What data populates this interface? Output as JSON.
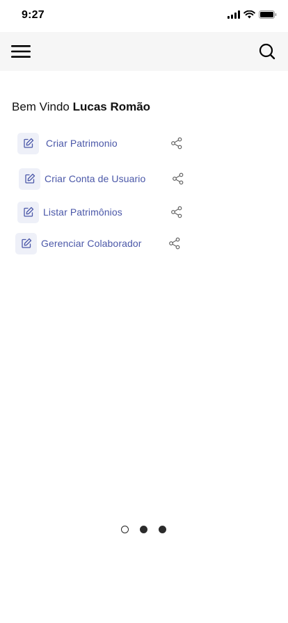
{
  "status_bar": {
    "time": "9:27",
    "icons": [
      "signal-icon",
      "wifi-icon",
      "battery-icon"
    ]
  },
  "header": {
    "menu_icon": "hamburger-menu-icon",
    "search_icon": "search-icon",
    "background": "#f6f6f6"
  },
  "welcome": {
    "greeting": "Bem Vindo",
    "user_name": "Lucas Romão"
  },
  "menu": {
    "items": [
      {
        "label": "Criar Patrimonio",
        "icon": "edit-icon",
        "action_icon": "share-icon"
      },
      {
        "label": "Criar Conta de Usuario",
        "icon": "edit-icon",
        "action_icon": "share-icon"
      },
      {
        "label": "Listar Patrimônios",
        "icon": "edit-icon",
        "action_icon": "share-icon"
      },
      {
        "label": "Gerenciar Colaborador",
        "icon": "edit-icon",
        "action_icon": "share-icon"
      }
    ],
    "label_color": "#4a57a8"
  },
  "pager": {
    "pages": 3,
    "active_index": 0
  }
}
